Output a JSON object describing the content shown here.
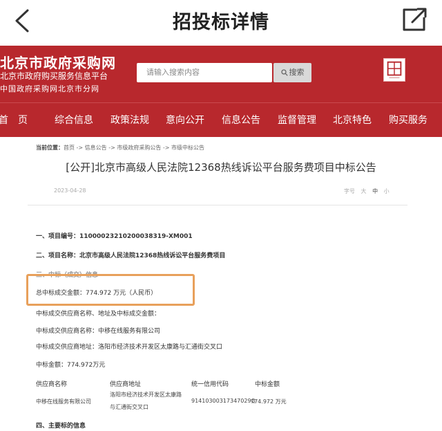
{
  "appbar": {
    "title": "招投标详情"
  },
  "site": {
    "logo_main": "北京市政府采购网",
    "logo_sub1": "北京市政府购买服务信息平台",
    "logo_sub2": "中国政府采购网北京市分网",
    "search_placeholder": "请输入搜索内容",
    "search_button": "搜索"
  },
  "nav": {
    "items": [
      "首　页",
      "综合信息",
      "政策法规",
      "意向公开",
      "信息公告",
      "监督管理",
      "北京特色",
      "购买服务"
    ]
  },
  "breadcrumb": {
    "label": "当前位置：",
    "path": "首页 -> 信息公告 -> 市级政府采购公告 -> 市级中标公告"
  },
  "document": {
    "title": "[公开]北京市高级人民法院12368热线诉讼平台服务费项目中标公告",
    "date": "2023-04-28",
    "font_label": "字号",
    "font_sizes": [
      "大",
      "中",
      "小"
    ],
    "project_no": "一、项目编号：11000023210200038319-XM001",
    "project_name": "二、项目名称：北京市高级人民法院12368热线诉讼平台服务费项目",
    "result_heading": "三、中标（成交）信息",
    "total_amount": "总中标成交金额：774.972 万元（人民币）",
    "supplier_heading": "中标成交供应商名称、地址及中标成交金额：",
    "supplier_name_line": "中标成交供应商名称：中移在线服务有限公司",
    "supplier_addr_line": "中标成交供应商地址：洛阳市经济技术开发区太康路与汇通街交叉口",
    "amount_line": "中标金额：774.972万元",
    "table": {
      "headers": [
        "供应商名称",
        "供应商地址",
        "统一信用代码",
        "中标金额"
      ],
      "row": {
        "name": "中移在线服务有限公司",
        "address_line1": "洛阳市经济技术开发区太康路",
        "address_line2": "与汇通街交叉口",
        "credit_code": "91410300317347029Q",
        "amount": "774.972 万元"
      }
    },
    "section4": "四、主要标的信息"
  },
  "colors": {
    "brand_red": "#b8282d",
    "highlight_orange": "#e8a05b"
  }
}
